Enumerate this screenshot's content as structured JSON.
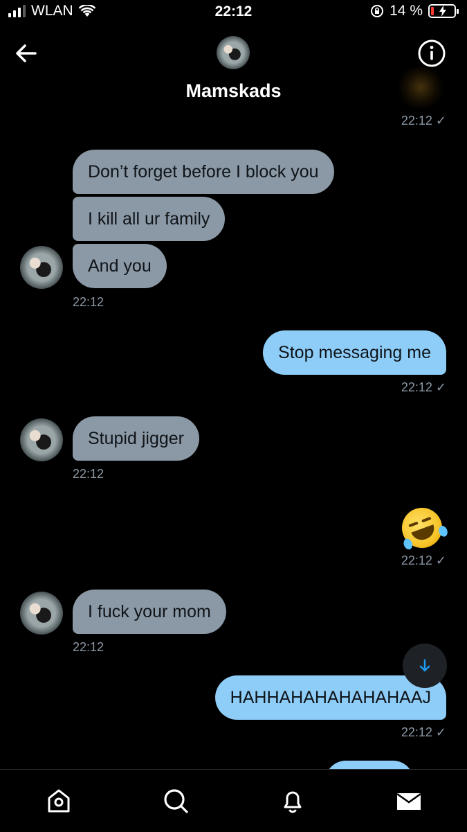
{
  "status_bar": {
    "carrier": "WLAN",
    "time": "22:12",
    "battery_percent": "14 %",
    "battery_level": 0.14,
    "battery_color": "#ff3b30"
  },
  "header": {
    "title": "Mamskads",
    "back_icon": "arrow-left-icon",
    "info_icon": "info-circle-icon"
  },
  "top_timestamp": "22:12",
  "messages": [
    {
      "direction": "incoming",
      "text": "Don’t forget before I block you"
    },
    {
      "direction": "incoming",
      "text": "I kill all ur family"
    },
    {
      "direction": "incoming",
      "text": "And you",
      "timestamp": "22:12"
    },
    {
      "direction": "outgoing",
      "text": "Stop messaging me",
      "timestamp": "22:12"
    },
    {
      "direction": "incoming",
      "text": "Stupid jigger",
      "timestamp": "22:12"
    },
    {
      "direction": "outgoing",
      "text": "🤣",
      "emoji": "rolling-on-floor-laughing",
      "timestamp": "22:12"
    },
    {
      "direction": "incoming",
      "text": "I fuck your mom",
      "timestamp": "22:12"
    },
    {
      "direction": "outgoing",
      "text": "HAHHAHAHAHAHAHAAJ",
      "timestamp": "22:12"
    }
  ],
  "bottom_nav": [
    {
      "icon": "home-icon"
    },
    {
      "icon": "search-icon"
    },
    {
      "icon": "notifications-bell-icon"
    },
    {
      "icon": "messages-envelope-icon",
      "active": true
    }
  ],
  "colors": {
    "background": "#000000",
    "incoming_bubble": "#8b98a5",
    "outgoing_bubble": "#8ecdf8",
    "timestamp": "#8b98a5"
  }
}
